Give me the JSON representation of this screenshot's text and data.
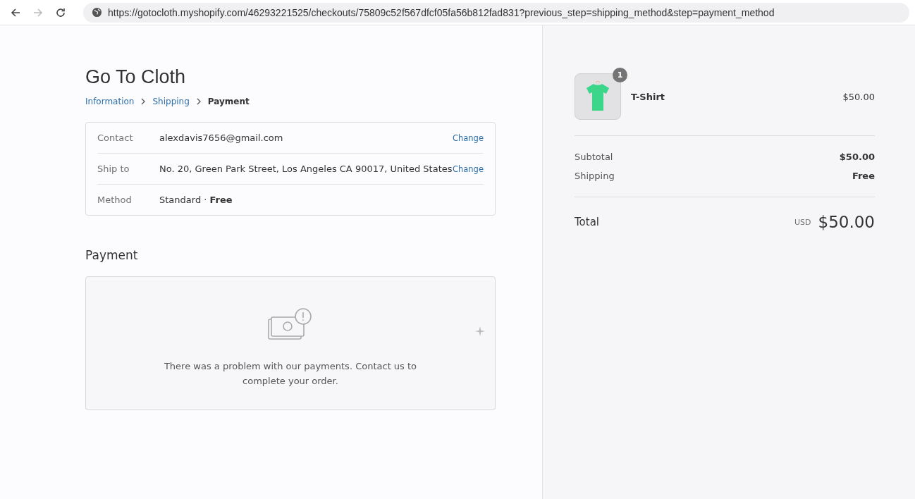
{
  "browser": {
    "url": "https://gotocloth.myshopify.com/46293221525/checkouts/75809c52f567dfcf05fa56b812fad831?previous_step=shipping_method&step=payment_method"
  },
  "shop": {
    "title": "Go To Cloth"
  },
  "breadcrumbs": [
    {
      "label": "Information",
      "current": false
    },
    {
      "label": "Shipping",
      "current": false
    },
    {
      "label": "Payment",
      "current": true
    }
  ],
  "review": [
    {
      "label": "Contact",
      "value": "alexdavis7656@gmail.com",
      "action": "Change"
    },
    {
      "label": "Ship to",
      "value": "No. 20, Green Park Street, Los Angeles CA 90017, United States",
      "action": "Change"
    },
    {
      "label": "Method",
      "value": "Standard · **Free**"
    }
  ],
  "payment": {
    "heading": "Payment",
    "message": "There was a problem with our payments. Contact us to complete your order."
  },
  "order": {
    "items": [
      {
        "name": "T-Shirt",
        "quantity": "1",
        "price": "$50.00"
      }
    ],
    "lines": [
      {
        "label": "Subtotal",
        "value": "$50.00"
      },
      {
        "label": "Shipping",
        "value": "Free"
      }
    ],
    "total": {
      "label": "Total",
      "currency": "USD",
      "value": "$50.00"
    }
  }
}
